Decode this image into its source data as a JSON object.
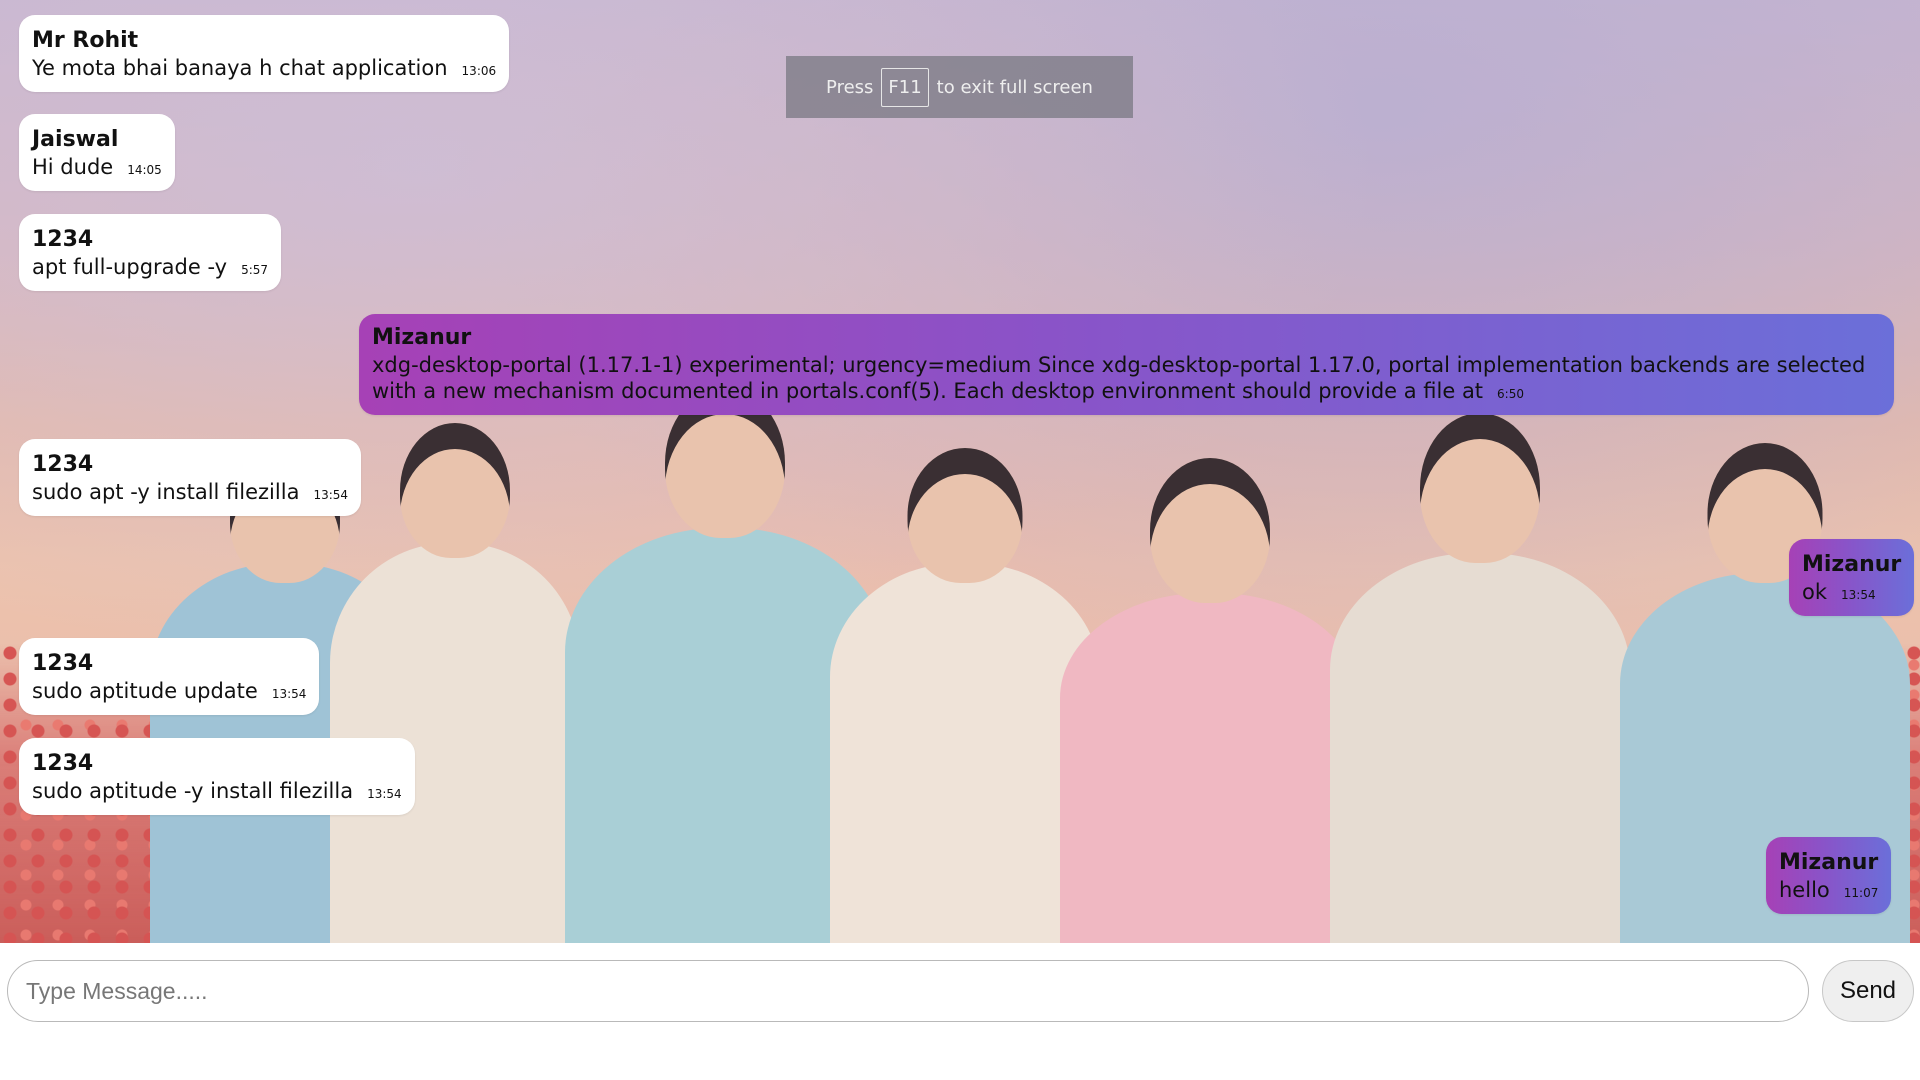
{
  "fullscreen_notice": {
    "press": "Press",
    "key": "F11",
    "rest": "to exit full screen"
  },
  "messages": [
    {
      "sender": "Mr Rohit",
      "text": "Ye mota bhai banaya h chat application",
      "time": "13:06",
      "mine": false
    },
    {
      "sender": "Jaiswal",
      "text": "Hi dude",
      "time": "14:05",
      "mine": false
    },
    {
      "sender": "1234",
      "text": "apt full-upgrade -y",
      "time": "5:57",
      "mine": false
    },
    {
      "sender": "Mizanur",
      "text": "xdg-desktop-portal (1.17.1-1) experimental; urgency=medium Since xdg-desktop-portal 1.17.0, portal implementation backends are selected with a new mechanism documented in portals.conf(5). Each desktop environment should provide a file at",
      "time": "6:50",
      "mine": true
    },
    {
      "sender": "1234",
      "text": "sudo apt -y install filezilla",
      "time": "13:54",
      "mine": false
    },
    {
      "sender": "Mizanur",
      "text": "ok",
      "time": "13:54",
      "mine": true
    },
    {
      "sender": "1234",
      "text": "sudo aptitude update",
      "time": "13:54",
      "mine": false
    },
    {
      "sender": "1234",
      "text": "sudo aptitude -y install filezilla",
      "time": "13:54",
      "mine": false
    },
    {
      "sender": "Mizanur",
      "text": "hello",
      "time": "11:07",
      "mine": true
    }
  ],
  "composer": {
    "placeholder": "Type Message.....",
    "value": "",
    "send_label": "Send"
  },
  "colors": {
    "own_bubble_start": "#a641b6",
    "own_bubble_end": "#6b6fd9",
    "other_bubble": "#ffffff"
  }
}
